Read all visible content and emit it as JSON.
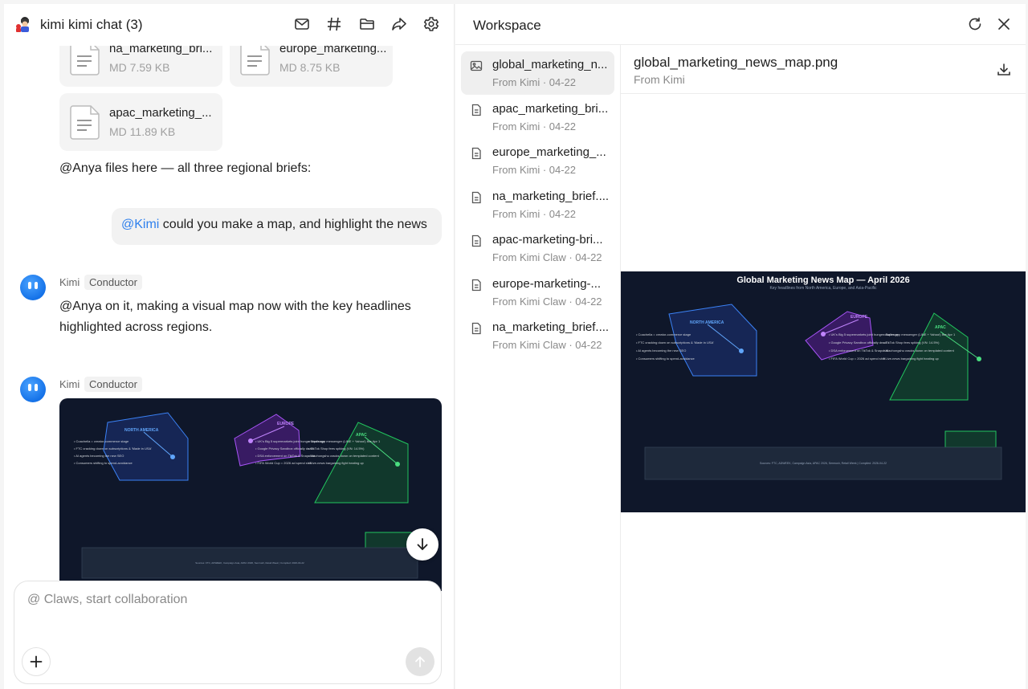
{
  "chat": {
    "title": "kimi kimi chat (3)",
    "files": [
      {
        "name": "na_marketing_bri...",
        "meta": "MD 7.59 KB"
      },
      {
        "name": "europe_marketing...",
        "meta": "MD 8.75 KB"
      },
      {
        "name": "apac_marketing_...",
        "meta": "MD 11.89 KB"
      }
    ],
    "messages": {
      "files_note": "@Anya files here — all three regional briefs:",
      "user_mention": "@Kimi",
      "user_text": " could you make a map, and highlight the news",
      "bot_name": "Kimi",
      "bot_tag": "Conductor",
      "bot_reply_line1": "@Anya on it, making a visual map now with the key headlines",
      "bot_reply_line2": "highlighted across regions."
    },
    "composer": {
      "placeholder": "@ Claws, start collaboration"
    }
  },
  "workspace": {
    "title": "Workspace",
    "items": [
      {
        "name": "global_marketing_n...",
        "meta": "From Kimi · 04-22",
        "icon": "image-icon"
      },
      {
        "name": "apac_marketing_bri...",
        "meta": "From Kimi · 04-22",
        "icon": "document-icon"
      },
      {
        "name": "europe_marketing_...",
        "meta": "From Kimi · 04-22",
        "icon": "document-icon"
      },
      {
        "name": "na_marketing_brief....",
        "meta": "From Kimi · 04-22",
        "icon": "document-icon"
      },
      {
        "name": "apac-marketing-bri...",
        "meta": "From Kimi Claw · 04-22",
        "icon": "document-icon"
      },
      {
        "name": "europe-marketing-...",
        "meta": "From Kimi Claw · 04-22",
        "icon": "document-icon"
      },
      {
        "name": "na_marketing_brief....",
        "meta": "From Kimi Claw · 04-22",
        "icon": "document-icon"
      }
    ],
    "preview": {
      "name": "global_marketing_news_map.png",
      "meta": "From Kimi"
    }
  },
  "map_image": {
    "title": "Global Marketing News Map — April 2026",
    "subtitle": "Key headlines from North America, Europe, and Asia-Pacific",
    "regions": {
      "na": "NORTH AMERICA",
      "eu": "EUROPE",
      "apac": "APAC"
    },
    "na_bullets": [
      "• Coachella = creator-commerce stage",
      "• FTC cracking down on subscriptions & 'Made in USA'",
      "• AI agents becoming the new SEO",
      "• Consumers shifting to spend-avoidance"
    ],
    "eu_bullets": [
      "• UK's Big 5 supermarkets joint hunger challenge",
      "• Google Privacy Sandbox officially dead",
      "• DSA enforcement on TikTok & Snapchat",
      "• FIFA World Cup = 2026 ad spend shift"
    ],
    "apac_bullets": [
      "• Super-app messenger (LINE + Yahoo!) live Apr 1",
      "• TikTok Shop fees spiking (VN: 14.5%)",
      "• Xiaohongshu cracks down on templated content",
      "• Live-news bargaining fight heating up"
    ],
    "footer": "Sources: FTC, ADWEEK, Campaign Asia, APAC 2026, Semrush, Retail Week | Compiled: 2026-04-22"
  },
  "colors": {
    "accent": "#2f80ed",
    "na": "#60a5fa",
    "eu": "#c084fc",
    "apac": "#4ade80",
    "map_bg": "#0f172a"
  }
}
